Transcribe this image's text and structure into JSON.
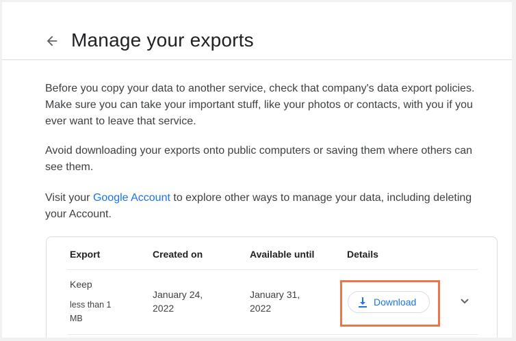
{
  "header": {
    "title": "Manage your exports"
  },
  "intro": {
    "p1": "Before you copy your data to another service, check that company's data export policies. Make sure you can take your important stuff, like your photos or contacts, with you if you ever want to leave that service.",
    "p2": "Avoid downloading your exports onto public computers or saving them where others can see them.",
    "p3_before": "Visit your ",
    "p3_link": "Google Account",
    "p3_after": " to explore other ways to manage your data, including deleting your Account."
  },
  "table": {
    "headers": [
      "Export",
      "Created on",
      "Available until",
      "Details"
    ],
    "rows": [
      {
        "export": "Keep",
        "size": "less than 1 MB",
        "created": "January 24, 2022",
        "available": "January 31, 2022",
        "action": "Download"
      }
    ]
  }
}
